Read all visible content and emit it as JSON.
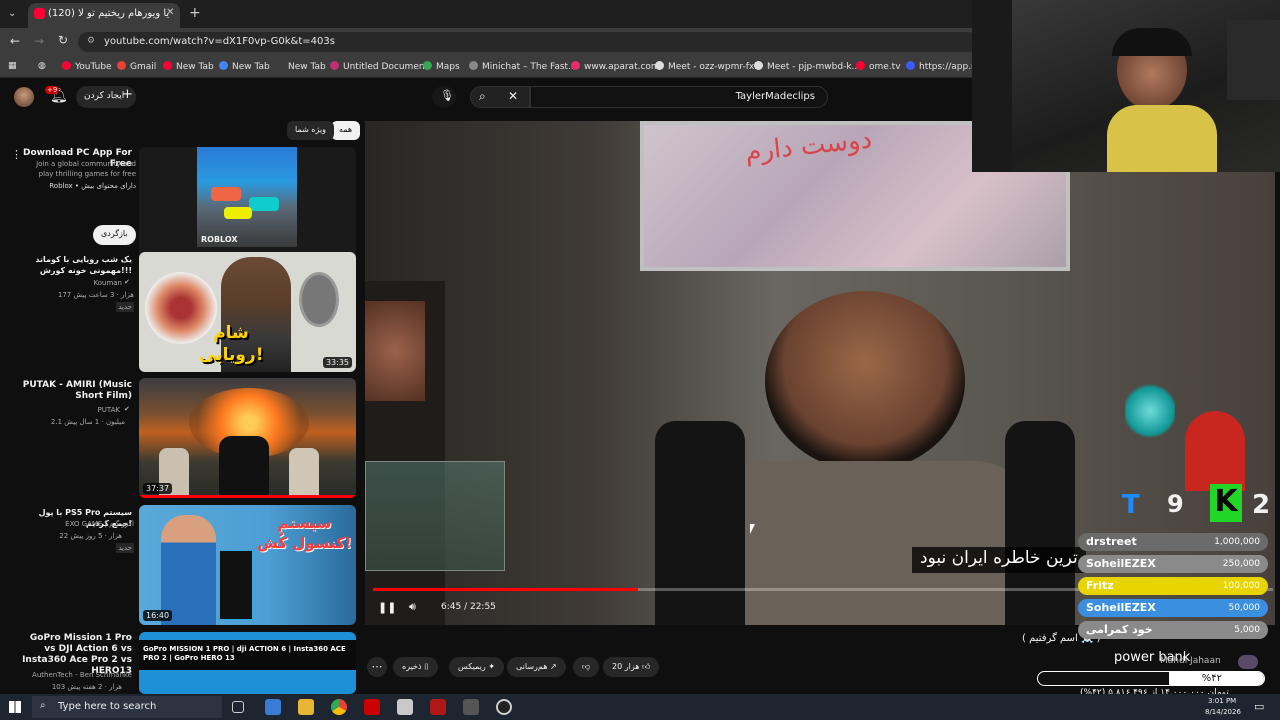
{
  "browser": {
    "tab_title": "(120) یا ویورهام ریختیم تو لا",
    "url": "youtube.com/watch?v=dX1F0vp-G0k&t=403s",
    "bookmarks": [
      "YouTube",
      "Gmail",
      "New Tab",
      "New Tab",
      "New Tab",
      "Untitled Document",
      "Maps",
      "Minichat – The Fast...",
      "www.aparat.com",
      "Meet - ozz-wpmr-fxi",
      "Meet - pjp-mwbd-k...",
      "ome.tv",
      "https://app.res"
    ]
  },
  "youtube": {
    "search_query": "TaylerMadeclips",
    "create_label": "ایجاد کردن",
    "notif_count": "+9",
    "chips": [
      "همه",
      "ویژه شما"
    ],
    "back_button": "بازگردی",
    "ad": {
      "title": "Download PC App For Free",
      "desc": "Join a global community and play thrilling games for free",
      "sponsor": "Roblox • دارای محتوای بیش",
      "thumb_label": "ROBLOX"
    },
    "sidebar": [
      {
        "title": "یک شب رویایی با کوماند مهمونی خونه کورش!!!",
        "channel": "Kouman",
        "meta": "177 هزار · 3 ساعت پیش",
        "badge": "جدید",
        "duration": "33:35",
        "thumb_text": "شام رویایی!"
      },
      {
        "title": "PUTAK - AMIRI (Music Short Film)",
        "channel": "PUTAK",
        "meta": "2.1 میلیون · 1 سال پیش",
        "badge": "",
        "duration": "37:37",
        "thumb_text": ""
      },
      {
        "title": "با پول PS5 Pro سیستم جمع کردیم!",
        "channel": "EXO GAME | اگزو گیم",
        "meta": "22 هزار · 5 روز پیش",
        "badge": "جدید",
        "duration": "16:40",
        "thumb_text": "سیستم کنسول کُش!"
      },
      {
        "title": "GoPro Mission 1 Pro vs DJI Action 6 vs Insta360 Ace Pro 2 vs HERO13",
        "channel": "AuthenTech - Ben Schmanke",
        "meta": "103 هزار · 2 هفته پیش",
        "badge": "",
        "duration": "",
        "thumb_text": "GoPro MISSION 1 PRO | dji ACTION 6 | Insta360 ACE PRO 2 | GoPro HERO 13"
      }
    ],
    "player": {
      "time": "6:45 / 22:55",
      "progress": 0.294,
      "caption": "ترین خاطره ایران نبود",
      "wall_text": "دوست دارم"
    },
    "actions": {
      "like": "20 هزار",
      "share": "هم‌رسانی",
      "remix": "ریمیکس",
      "save": "ذخیره"
    },
    "comment_line": "( اسم گرفتیم ☠️ )"
  },
  "overlay": {
    "score_left": "9",
    "score_right": "2",
    "donors": [
      {
        "name": "drstreet",
        "amount": "1,000,000",
        "color": "#6b6b6b"
      },
      {
        "name": "SoheilEZEX",
        "amount": "250,000",
        "color": "#8a8a8a"
      },
      {
        "name": "Fritz",
        "amount": "100,000",
        "color": "#e8d400"
      },
      {
        "name": "SoheilEZEX",
        "amount": "50,000",
        "color": "#3a8fe0"
      },
      {
        "name": "خود کمرامی",
        "amount": "5,000",
        "color": "#8a8a8a"
      }
    ],
    "power_bank": "power bank",
    "user": "Mahdi Jahaan",
    "goal_percent_label": "%۴۲",
    "goal_fraction": 0.42,
    "goal_text": "(%۴۲) تومان ۱۴,۰۰۰,۰۰۰ از ۵,۸۱۶,۴۹۶"
  },
  "taskbar": {
    "search_placeholder": "Type here to search",
    "time": "3:01 PM",
    "date": "8/14/2026"
  }
}
